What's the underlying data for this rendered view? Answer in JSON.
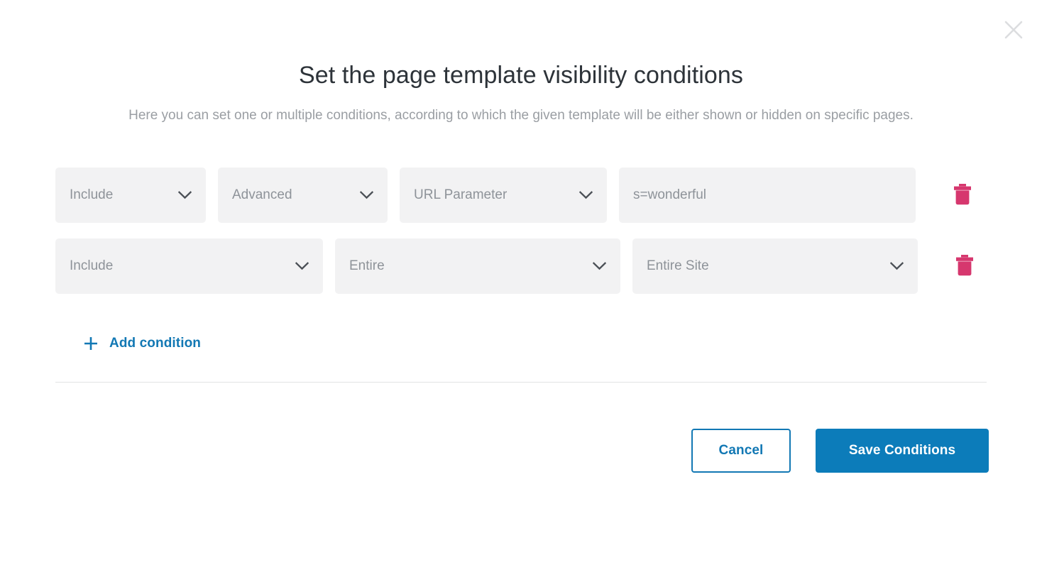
{
  "dialog": {
    "title": "Set the page template visibility conditions",
    "subtitle": "Here you can set one or multiple conditions, according to which the given template will be either shown or hidden on specific pages.",
    "close_icon": "close-icon"
  },
  "conditions": {
    "rows": [
      {
        "inclusion": {
          "value": "Include",
          "icon": "chevron-down-icon"
        },
        "category": {
          "value": "Advanced",
          "icon": "chevron-down-icon"
        },
        "type": {
          "value": "URL Parameter",
          "icon": "chevron-down-icon"
        },
        "parameter": {
          "value": "s=wonderful",
          "placeholder": "s=wonderful"
        },
        "delete_icon": "trash-icon"
      },
      {
        "inclusion": {
          "value": "Include",
          "icon": "chevron-down-icon"
        },
        "category": {
          "value": "Entire",
          "icon": "chevron-down-icon"
        },
        "type": {
          "value": "Entire Site",
          "icon": "chevron-down-icon"
        },
        "delete_icon": "trash-icon"
      }
    ],
    "add_label": "Add condition",
    "add_icon": "plus-icon"
  },
  "footer": {
    "cancel_label": "Cancel",
    "save_label": "Save Conditions"
  },
  "colors": {
    "accent_blue": "#0c7cba",
    "link_blue": "#1278b4",
    "delete_pink": "#d6376e",
    "field_bg": "#f2f2f3",
    "title_text": "#2d3339",
    "muted_text": "#9a9ea3",
    "value_text": "#8e9399",
    "divider": "#e2e3e4"
  }
}
